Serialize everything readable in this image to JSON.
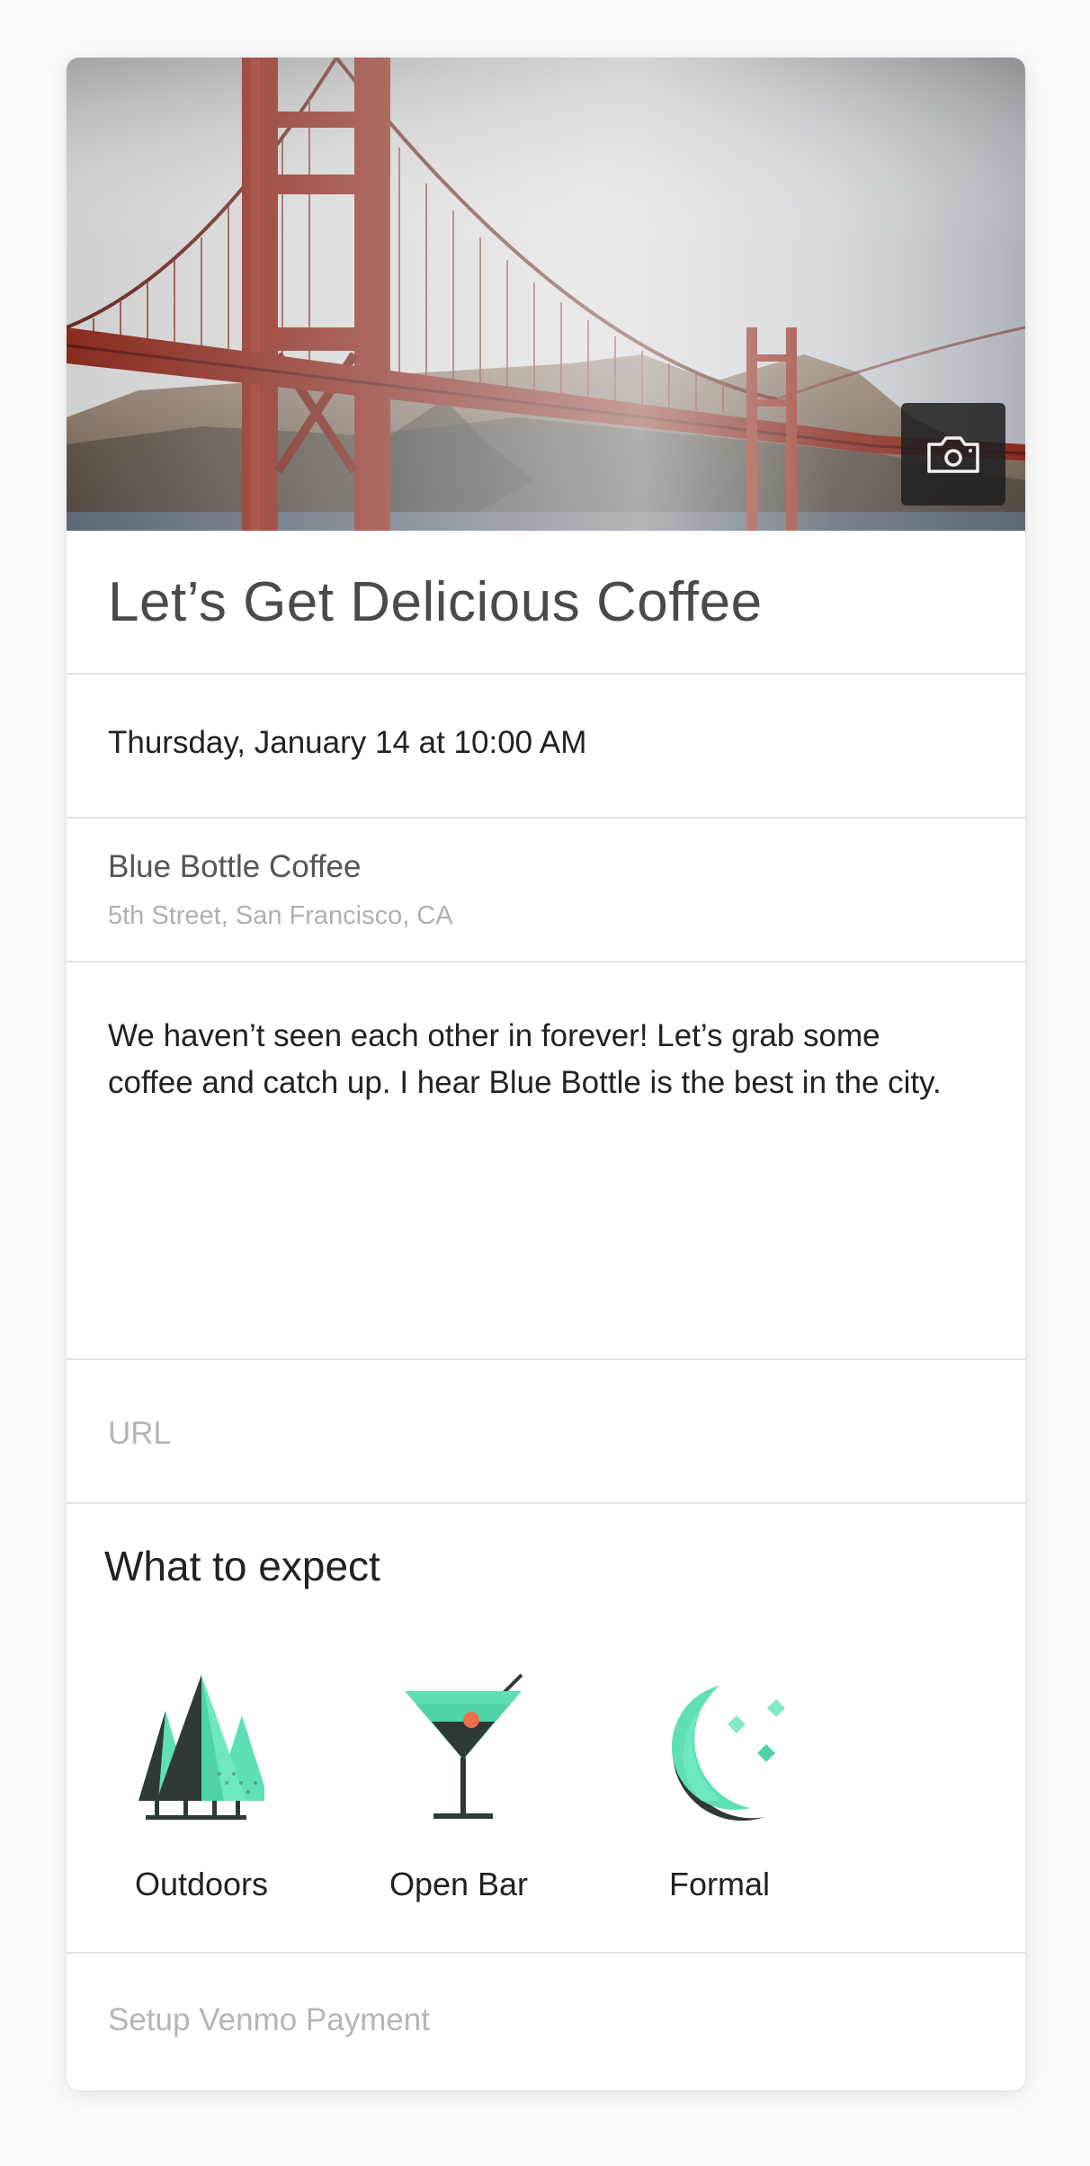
{
  "event": {
    "title": "Let’s Get Delicious Coffee",
    "datetime": "Thursday, January 14 at 10:00 AM",
    "location": {
      "name": "Blue Bottle Coffee",
      "address": "5th Street, San Francisco, CA"
    },
    "description": "We haven’t seen each other in forever! Let’s grab some coffee and catch up. I hear Blue Bottle is the best in the city.",
    "url": {
      "value": "",
      "placeholder": "URL"
    }
  },
  "expect": {
    "heading": "What to expect",
    "options": [
      {
        "label": "Outdoors",
        "icon": "trees-icon"
      },
      {
        "label": "Open Bar",
        "icon": "cocktail-icon"
      },
      {
        "label": "Formal",
        "icon": "moon-icon"
      }
    ]
  },
  "payment": {
    "label": "Setup Venmo Payment"
  },
  "hero": {
    "icon": "camera-icon"
  },
  "colors": {
    "accent_mint": "#5ee0b4",
    "accent_dark": "#2f3a36",
    "accent_orange": "#f0704a",
    "divider": "#e4e4e4",
    "placeholder": "#b5b5b5"
  }
}
